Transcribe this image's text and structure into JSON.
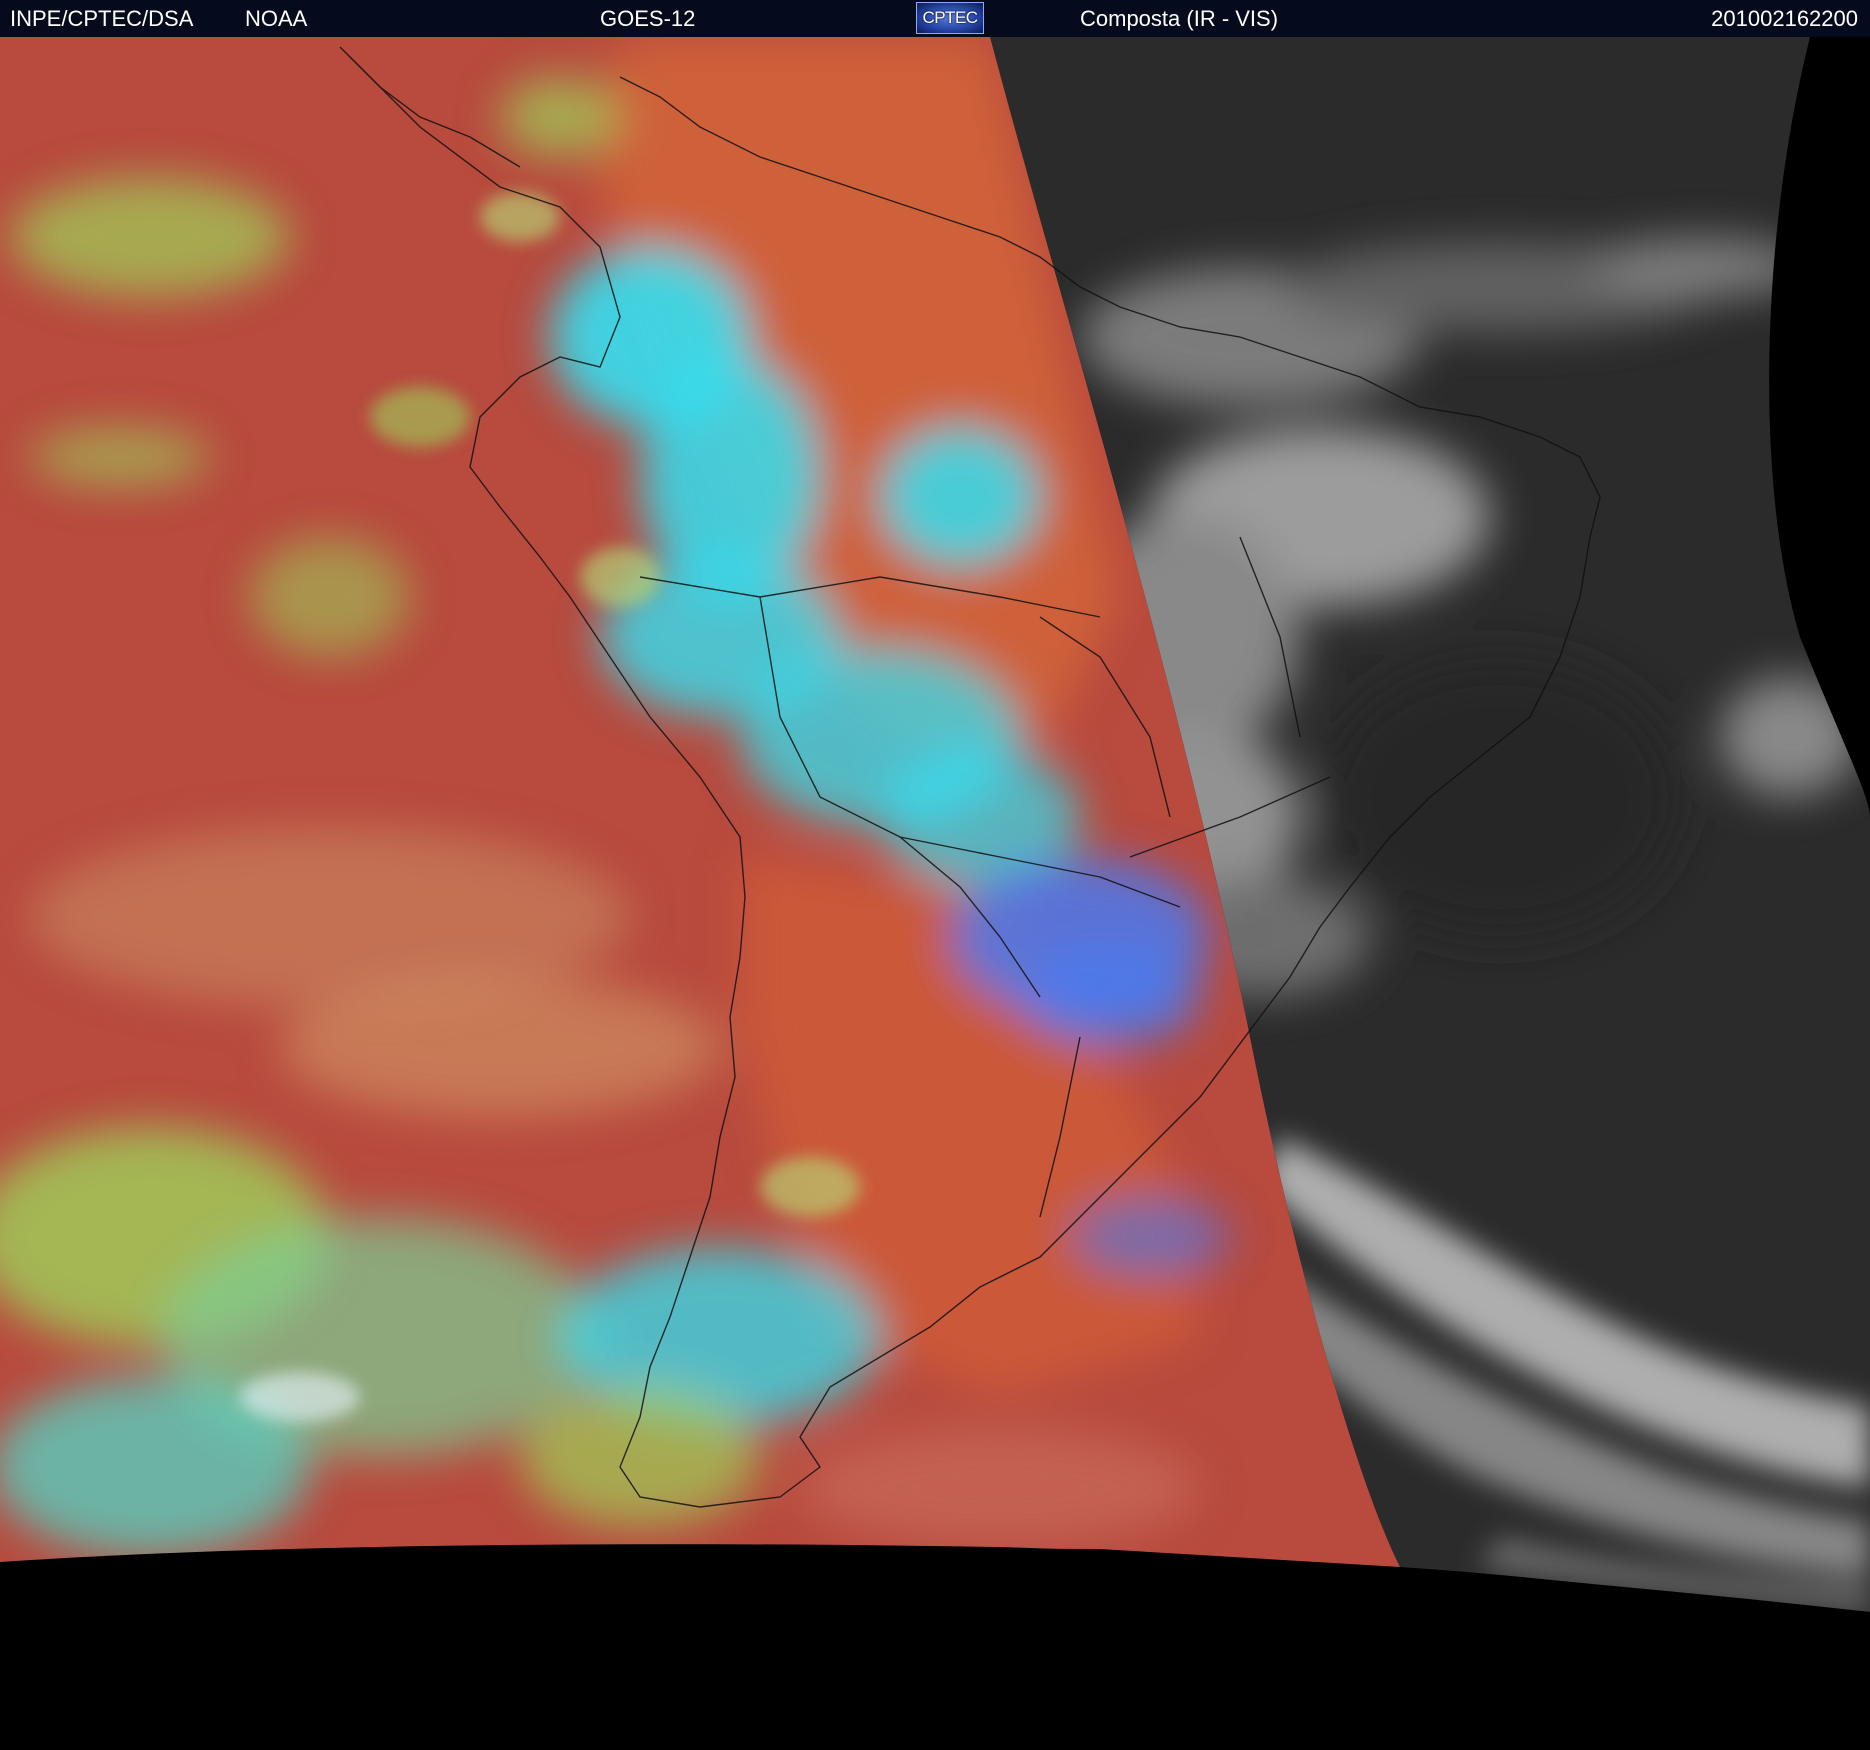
{
  "header": {
    "organization": "INPE/CPTEC/DSA",
    "agency": "NOAA",
    "satellite": "GOES-12",
    "logo_text": "CPTEC",
    "product": "Composta (IR - VIS)",
    "timestamp": "201002162200"
  },
  "colors": {
    "header_bg": "#050a1c",
    "ir_base": "#b84a3e",
    "ir_orange": "#d2643a",
    "cloud_cyan": "#33e0f2",
    "cloud_green": "#9fd25a",
    "cloud_blue": "#4a7af0",
    "vis_base": "#2b2b2b",
    "vis_cloud": "#cfcfcf",
    "space": "#000000"
  }
}
